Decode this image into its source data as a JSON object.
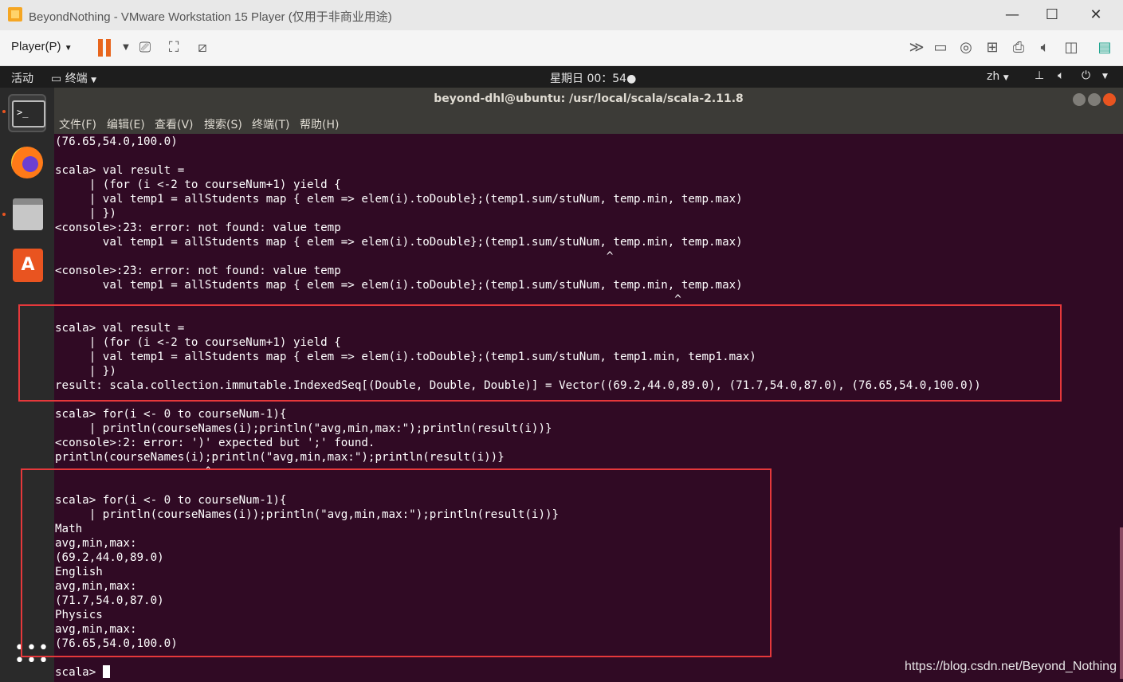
{
  "vmware": {
    "window_title": "BeyondNothing - VMware Workstation 15 Player (仅用于非商业用途)",
    "player_menu": "Player(P)",
    "win_minimize": "—",
    "win_maximize": "☐",
    "win_close": "✕"
  },
  "ubuntu": {
    "activities": "活动",
    "app_menu": "终端",
    "clock": "星期日 00：54",
    "language": "zh"
  },
  "terminal": {
    "title": "beyond-dhl@ubuntu: /usr/local/scala/scala-2.11.8",
    "menu": [
      "文件(F)",
      "编辑(E)",
      "查看(V)",
      "搜索(S)",
      "终端(T)",
      "帮助(H)"
    ],
    "output": "(76.65,54.0,100.0)\n\nscala> val result =\n     | (for (i <-2 to courseNum+1) yield {\n     | val temp1 = allStudents map { elem => elem(i).toDouble};(temp1.sum/stuNum, temp.min, temp.max)\n     | })\n<console>:23: error: not found: value temp\n       val temp1 = allStudents map { elem => elem(i).toDouble};(temp1.sum/stuNum, temp.min, temp.max)\n                                                                                 ^\n<console>:23: error: not found: value temp\n       val temp1 = allStudents map { elem => elem(i).toDouble};(temp1.sum/stuNum, temp.min, temp.max)\n                                                                                           ^\n\nscala> val result =\n     | (for (i <-2 to courseNum+1) yield {\n     | val temp1 = allStudents map { elem => elem(i).toDouble};(temp1.sum/stuNum, temp1.min, temp1.max)\n     | })\nresult: scala.collection.immutable.IndexedSeq[(Double, Double, Double)] = Vector((69.2,44.0,89.0), (71.7,54.0,87.0), (76.65,54.0,100.0))\n\nscala> for(i <- 0 to courseNum-1){\n     | println(courseNames(i);println(\"avg,min,max:\");println(result(i))}\n<console>:2: error: ')' expected but ';' found.\nprintln(courseNames(i);println(\"avg,min,max:\");println(result(i))}\n                      ^\n\nscala> for(i <- 0 to courseNum-1){\n     | println(courseNames(i));println(\"avg,min,max:\");println(result(i))}\nMath\navg,min,max:\n(69.2,44.0,89.0)\nEnglish\navg,min,max:\n(71.7,54.0,87.0)\nPhysics\navg,min,max:\n(76.65,54.0,100.0)\n\n",
    "prompt": "scala> "
  },
  "watermark": "https://blog.csdn.net/Beyond_Nothing",
  "colors": {
    "terminal_bg": "#300a24",
    "annotation_red": "#e5383b",
    "ubuntu_orange": "#e95420"
  }
}
